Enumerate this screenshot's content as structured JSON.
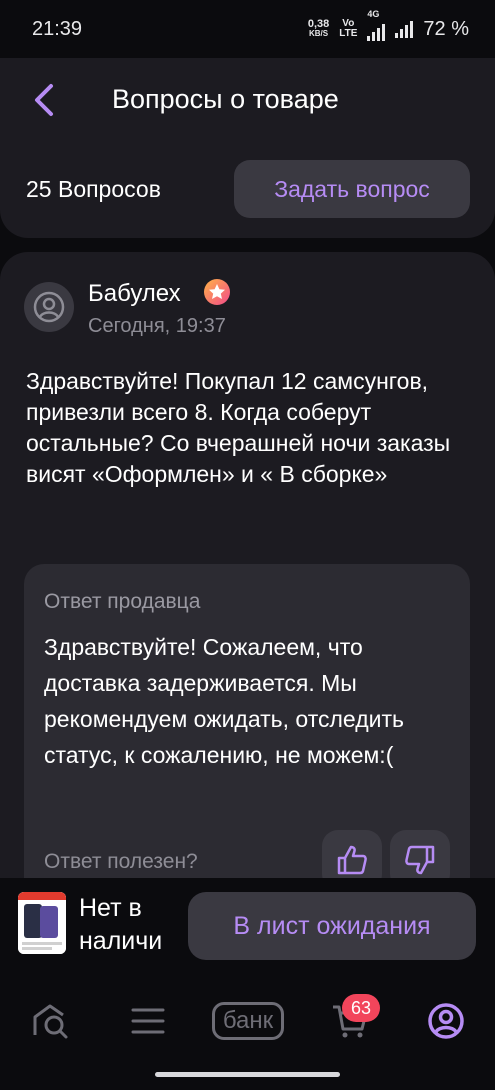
{
  "status_bar": {
    "time": "21:39",
    "net_speed_value": "0,38",
    "net_speed_unit": "KB/S",
    "vo_tag": "Vo",
    "lte_tag": "LTE",
    "network_4g": "4G",
    "battery": "72 %"
  },
  "header": {
    "title": "Вопросы о товаре",
    "questions_count": "25 Вопросов",
    "ask_button": "Задать вопрос"
  },
  "question": {
    "author": "Бабулех",
    "date": "Сегодня, 19:37",
    "text": "Здравствуйте! Покупал 12 самсунгов, привезли всего 8. Когда соберут остальные? Со вчерашней ночи заказы висят «Оформлен» и « В сборке»",
    "answer": {
      "title": "Ответ продавца",
      "text": "Здравствуйте! Сожалеем, что доставка задерживается. Мы рекомендуем ожидать, отследить статус, к сожалению, не можем:(",
      "helpful_label": "Ответ полезен?"
    }
  },
  "bottom_bar": {
    "stock_status": "Нет в наличи",
    "waitlist_button": "В лист ожидания"
  },
  "nav": {
    "items": [
      "home-search-icon",
      "menu-icon",
      "bank",
      "cart-icon",
      "profile-icon"
    ],
    "bank_label": "банк",
    "cart_count": "63"
  },
  "colors": {
    "accent": "#b68cf4",
    "background": "#0b0b0e",
    "card": "#1c1b21",
    "button": "#3a3941",
    "badge": "#f2455b"
  }
}
